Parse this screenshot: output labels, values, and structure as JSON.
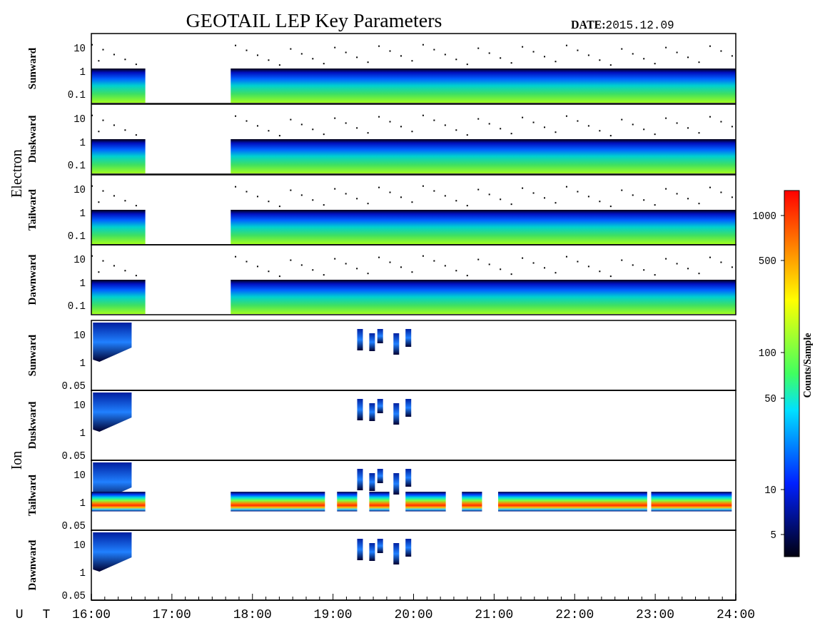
{
  "title": "GEOTAIL LEP Key Parameters",
  "date": {
    "label": "DATE:",
    "value": "2015.12.09"
  },
  "groups": [
    {
      "name": "Electron",
      "panels": [
        {
          "direction": "Sunward",
          "kind": "electron",
          "yticks": [
            "10",
            "1",
            "0.1"
          ]
        },
        {
          "direction": "Duskward",
          "kind": "electron",
          "yticks": [
            "10",
            "1",
            "0.1"
          ]
        },
        {
          "direction": "Tailward",
          "kind": "electron",
          "yticks": [
            "10",
            "1",
            "0.1"
          ]
        },
        {
          "direction": "Dawnward",
          "kind": "electron",
          "yticks": [
            "10",
            "1",
            "0.1"
          ]
        }
      ]
    },
    {
      "name": "Ion",
      "panels": [
        {
          "direction": "Sunward",
          "kind": "ion-sparse",
          "yticks": [
            "10",
            "1",
            "0.05"
          ]
        },
        {
          "direction": "Duskward",
          "kind": "ion-sparse",
          "yticks": [
            "10",
            "1",
            "0.05"
          ]
        },
        {
          "direction": "Tailward",
          "kind": "ion-band",
          "yticks": [
            "10",
            "1",
            "0.05"
          ]
        },
        {
          "direction": "Dawnward",
          "kind": "ion-sparse",
          "yticks": [
            "10",
            "1",
            "0.05"
          ]
        }
      ]
    }
  ],
  "x_axis": {
    "label": "U T",
    "ticks": [
      "16:00",
      "17:00",
      "18:00",
      "19:00",
      "20:00",
      "21:00",
      "22:00",
      "23:00",
      "24:00"
    ]
  },
  "colorbar": {
    "label": "Counts/Sample",
    "ticks": [
      "1000",
      "500",
      "100",
      "50",
      "10",
      "5"
    ]
  }
}
